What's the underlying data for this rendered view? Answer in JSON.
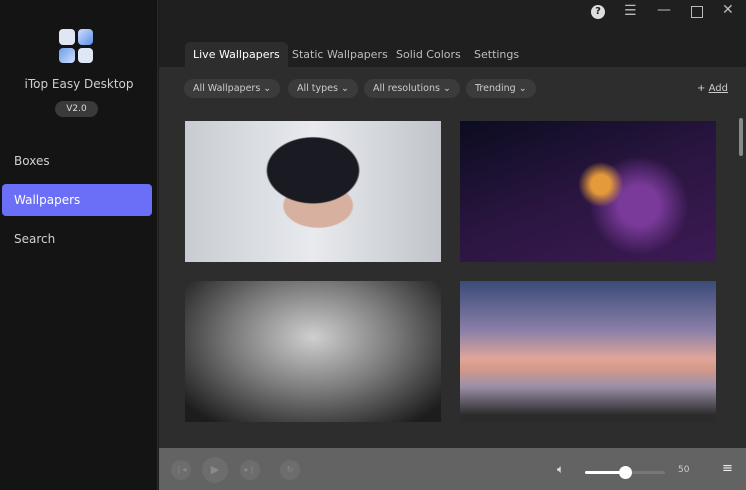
{
  "app": {
    "name": "iTop Easy Desktop",
    "version": "V2.0"
  },
  "sidebar": {
    "items": [
      {
        "label": "Boxes",
        "active": false
      },
      {
        "label": "Wallpapers",
        "active": true
      },
      {
        "label": "Search",
        "active": false
      }
    ]
  },
  "window_controls": [
    "help-icon",
    "menu-icon",
    "minimize-icon",
    "maximize-icon",
    "close-icon"
  ],
  "tabs": [
    {
      "label": "Live Wallpapers",
      "active": true
    },
    {
      "label": "Static Wallpapers"
    },
    {
      "label": "Solid Colors"
    },
    {
      "label": "Settings"
    }
  ],
  "filters": [
    {
      "label": "All Wallpapers"
    },
    {
      "label": "All types"
    },
    {
      "label": "All resolutions"
    },
    {
      "label": "Trending"
    }
  ],
  "add": {
    "icon": "+",
    "label": "Add"
  },
  "wallpapers": [
    "anime-girl",
    "glowing-mushrooms",
    "rain-on-glass",
    "birds-sunset"
  ],
  "player": {
    "volume": 50,
    "volume_label": "50"
  },
  "colors": {
    "accent": "#6b6ff7",
    "sidebar_bg": "#141414",
    "content_bg": "#2d2d2d",
    "footer_bg": "#636363"
  }
}
